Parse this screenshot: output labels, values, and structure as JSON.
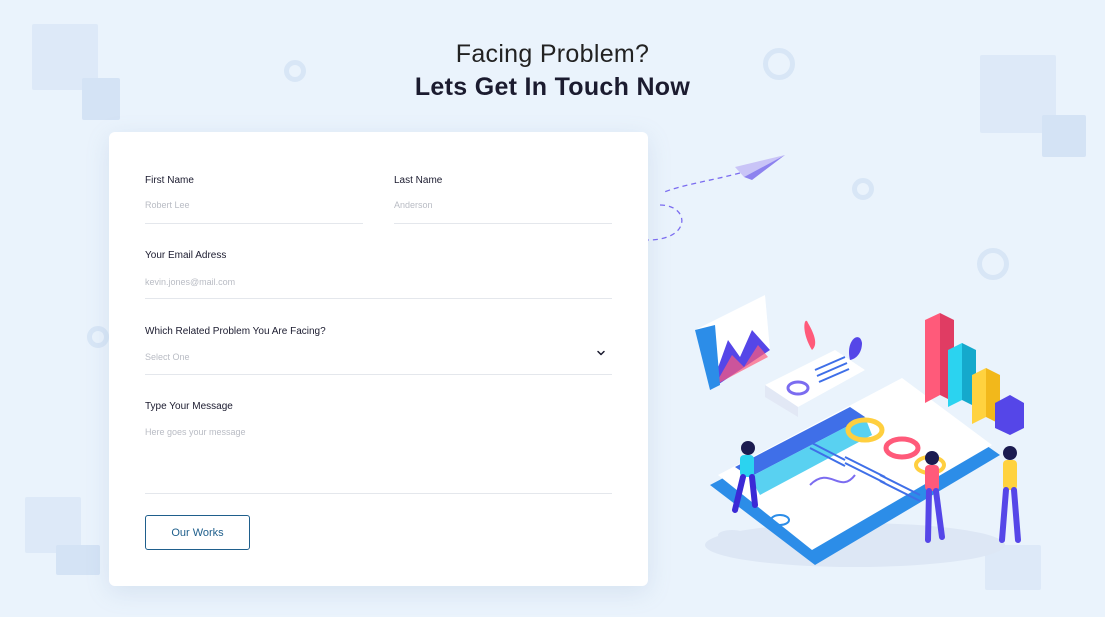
{
  "heading": {
    "line1": "Facing Problem?",
    "line2": "Lets Get In Touch Now"
  },
  "form": {
    "first_name": {
      "label": "First Name",
      "placeholder": "Robert Lee"
    },
    "last_name": {
      "label": "Last Name",
      "placeholder": "Anderson"
    },
    "email": {
      "label": "Your Email Adress",
      "placeholder": "kevin.jones@mail.com"
    },
    "problem": {
      "label": "Which Related Problem You Are Facing?",
      "selected": "Select One"
    },
    "message": {
      "label": "Type Your Message",
      "placeholder": "Here goes your message"
    },
    "submit_label": "Our Works"
  },
  "icons": {
    "dropdown": "chevron-down-icon",
    "paper_plane": "paper-plane-icon"
  },
  "colors": {
    "background": "#eaf3fc",
    "button_border": "#1f5f8c",
    "accent_pink": "#ff5a7a",
    "accent_cyan": "#2bd3f0",
    "accent_yellow": "#ffd23f",
    "accent_purple": "#5546e8"
  }
}
